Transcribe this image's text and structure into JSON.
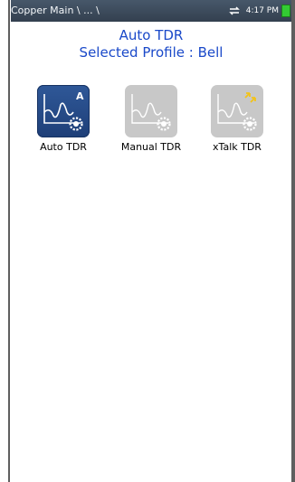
{
  "status_bar": {
    "breadcrumb": "Copper Main \\ ... \\",
    "time": "4:17 PM",
    "colors": {
      "background": "#3d4c5d",
      "battery": "#33cc33"
    }
  },
  "header": {
    "title": "Auto TDR",
    "subtitle": "Selected Profile : Bell",
    "color": "#1a49c9"
  },
  "tests": [
    {
      "label": "Auto TDR",
      "state": "selected",
      "icon": "auto-tdr-icon"
    },
    {
      "label": "Manual TDR",
      "state": "disabled",
      "icon": "manual-tdr-icon"
    },
    {
      "label": "xTalk TDR",
      "state": "disabled",
      "icon": "xtalk-tdr-icon"
    }
  ]
}
